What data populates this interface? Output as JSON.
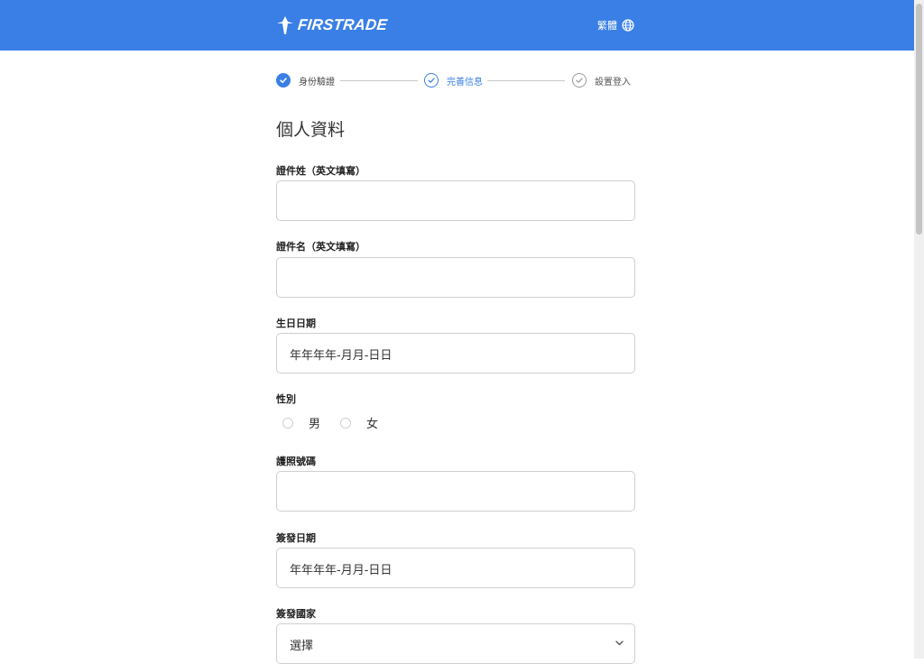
{
  "header": {
    "brand": "FIRSTRADE",
    "language_label": "繁體",
    "language_icon": "globe-icon"
  },
  "colors": {
    "brand_blue": "#3a7fe6",
    "border": "#cfcfcf"
  },
  "stepper": {
    "steps": [
      {
        "label": "身份驗證",
        "status": "completed"
      },
      {
        "label": "完善信息",
        "status": "active"
      },
      {
        "label": "設置登入",
        "status": "pending"
      }
    ]
  },
  "form": {
    "title": "個人資料",
    "surname": {
      "label": "證件姓（英文填寫）",
      "value": ""
    },
    "given_name": {
      "label": "證件名（英文填寫）",
      "value": ""
    },
    "birth_date": {
      "label": "生日日期",
      "placeholder": "年年年年-月月-日日"
    },
    "gender": {
      "label": "性別",
      "options": [
        "男",
        "女"
      ],
      "selected": ""
    },
    "passport_number": {
      "label": "護照號碼",
      "value": ""
    },
    "issue_date": {
      "label": "簽發日期",
      "placeholder": "年年年年-月月-日日"
    },
    "issue_country": {
      "label": "簽發國家",
      "selected": "選擇"
    }
  }
}
